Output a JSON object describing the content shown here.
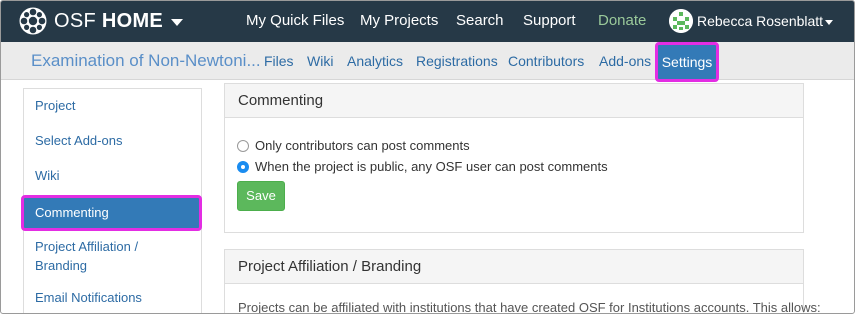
{
  "topnav": {
    "brand_prefix": "OSF",
    "brand_bold": "HOME",
    "links": [
      "My Quick Files",
      "My Projects",
      "Search",
      "Support",
      "Donate"
    ],
    "user_name": "Rebecca Rosenblatt"
  },
  "subnav": {
    "project_title": "Examination of Non-Newtoni...",
    "tabs": [
      "Files",
      "Wiki",
      "Analytics",
      "Registrations",
      "Contributors",
      "Add-ons",
      "Settings"
    ],
    "active_tab": "Settings"
  },
  "sidebar": {
    "items": [
      {
        "label": "Project"
      },
      {
        "label": "Select Add-ons"
      },
      {
        "label": "Wiki"
      },
      {
        "label": "Commenting"
      },
      {
        "label": "Project Affiliation /"
      },
      {
        "label": "Branding"
      },
      {
        "label": "Email Notifications"
      }
    ],
    "active": "Commenting"
  },
  "commenting": {
    "title": "Commenting",
    "option_contributors": "Only contributors can post comments",
    "option_public": "When the project is public, any OSF user can post comments",
    "selected": "option_public",
    "save_label": "Save"
  },
  "affiliation": {
    "title": "Project Affiliation / Branding",
    "description": "Projects can be affiliated with institutions that have created OSF for Institutions accounts. This allows:"
  },
  "colors": {
    "navbar": "#263947",
    "accent": "#337ab7",
    "highlight": "#e32de3",
    "save": "#5cb85c",
    "donate": "#9ac99a"
  }
}
